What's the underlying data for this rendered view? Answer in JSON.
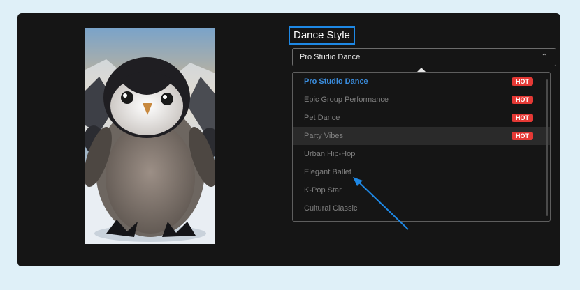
{
  "dance_style": {
    "title": "Dance Style",
    "selected_value": "Pro Studio Dance",
    "options": [
      {
        "label": "Pro Studio Dance",
        "badge": "HOT"
      },
      {
        "label": "Epic Group Performance",
        "badge": "HOT"
      },
      {
        "label": "Pet Dance",
        "badge": "HOT"
      },
      {
        "label": "Party Vibes",
        "badge": "HOT"
      },
      {
        "label": "Urban Hip-Hop"
      },
      {
        "label": "Elegant Ballet"
      },
      {
        "label": "K-Pop Star"
      },
      {
        "label": "Cultural Classic"
      }
    ]
  },
  "colors": {
    "accent_blue": "#1e88e5",
    "hot_badge": "#e53935",
    "panel_bg": "#151515",
    "page_bg": "#dff0f8"
  },
  "icons": {
    "select_chevron": "chevron-up-icon"
  }
}
